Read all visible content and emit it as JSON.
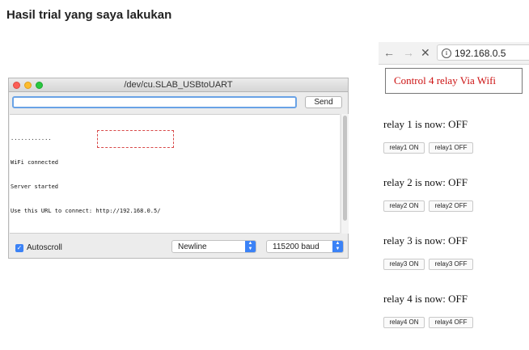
{
  "heading": "Hasil trial yang saya lakukan",
  "serial_monitor": {
    "window_title": "/dev/cu.SLAB_USBtoUART",
    "input_value": "",
    "send_label": "Send",
    "output_lines": [
      "............",
      "WiFi connected",
      "Server started",
      "Use this URL to connect: http://192.168.0.5/"
    ],
    "autoscroll_label": "Autoscroll",
    "autoscroll_checked": true,
    "line_ending": "Newline",
    "baud_rate": "115200 baud",
    "accent_color": "#3b82f6"
  },
  "browser": {
    "address": "192.168.0.5",
    "nav_back_icon": "back-arrow-icon",
    "nav_forward_icon": "forward-arrow-icon",
    "reload_icon": "close-x-icon",
    "page_title": "Control 4 relay Via Wifi",
    "title_color": "#cc1111",
    "relays": [
      {
        "status": "relay 1 is now: OFF",
        "on_label": "relay1 ON",
        "off_label": "relay1 OFF"
      },
      {
        "status": "relay 2 is now: OFF",
        "on_label": "relay2 ON",
        "off_label": "relay2 OFF"
      },
      {
        "status": "relay 3 is now: OFF",
        "on_label": "relay3 ON",
        "off_label": "relay3 OFF"
      },
      {
        "status": "relay 4 is now: OFF",
        "on_label": "relay4 ON",
        "off_label": "relay4 OFF"
      }
    ]
  }
}
